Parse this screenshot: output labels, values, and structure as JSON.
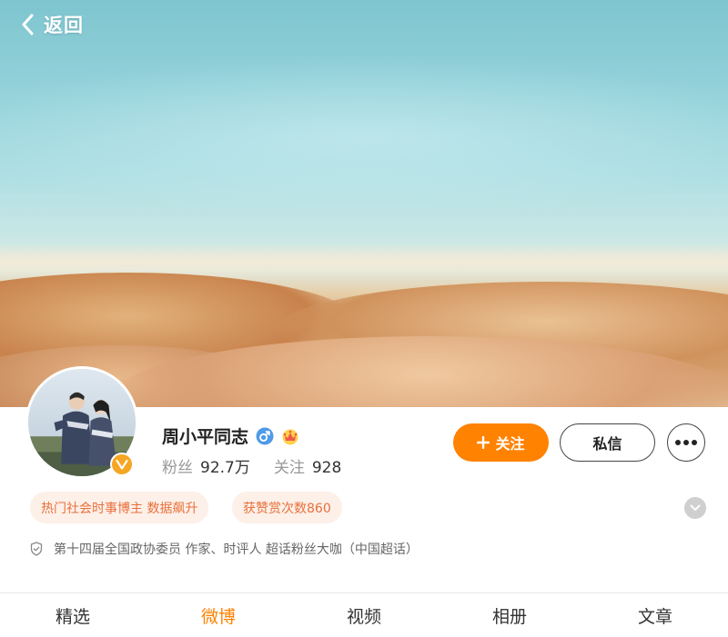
{
  "header": {
    "back_label": "返回",
    "back_icon": "chevron-left-icon"
  },
  "profile": {
    "name": "周小平同志",
    "gender_icon": "male-icon",
    "rank_icon": "crown-badge-icon",
    "verified_icon": "verified-v-icon",
    "fans_label": "粉丝",
    "fans_count": "92.7万",
    "following_label": "关注",
    "following_count": "928"
  },
  "actions": {
    "follow_icon": "plus-icon",
    "follow_label": "关注",
    "message_label": "私信",
    "more_icon": "more-dots-icon"
  },
  "tags": [
    "热门社会时事博主 数据飙升",
    "获赞赏次数860"
  ],
  "expand_icon": "chevron-down-icon",
  "description": {
    "icon": "shield-icon",
    "text": "第十四届全国政协委员 作家、时评人 超话粉丝大咖（中国超话）"
  },
  "tabs": [
    {
      "label": "精选",
      "active": false
    },
    {
      "label": "微博",
      "active": true
    },
    {
      "label": "视频",
      "active": false
    },
    {
      "label": "相册",
      "active": false
    },
    {
      "label": "文章",
      "active": false
    }
  ],
  "colors": {
    "accent": "#ff8200",
    "tag_bg": "#fdf0e8",
    "tag_text": "#e8703c",
    "verified": "#f6a623"
  }
}
